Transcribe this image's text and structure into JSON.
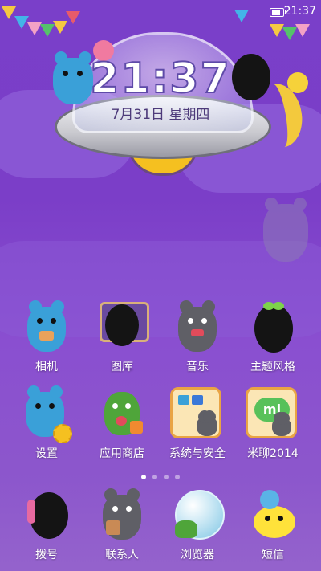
{
  "status_bar": {
    "time": "21:37",
    "battery_icon": "battery-icon"
  },
  "clock_widget": {
    "time": "21:37",
    "date": "7月31日  星期四"
  },
  "page_indicator": {
    "count": 4,
    "active_index": 0
  },
  "apps": [
    {
      "id": "camera",
      "label": "相机",
      "icon": "camera-bear-icon"
    },
    {
      "id": "gallery",
      "label": "图库",
      "icon": "gallery-monster-icon"
    },
    {
      "id": "music",
      "label": "音乐",
      "icon": "music-bear-icon"
    },
    {
      "id": "themes",
      "label": "主题风格",
      "icon": "themes-monster-icon"
    },
    {
      "id": "settings",
      "label": "设置",
      "icon": "settings-bear-icon"
    },
    {
      "id": "app-store",
      "label": "应用商店",
      "icon": "app-store-monster-icon"
    },
    {
      "id": "system-security",
      "label": "系统与安全",
      "icon": "security-folder-icon"
    },
    {
      "id": "miliao",
      "label": "米聊2014",
      "icon": "miliao-icon"
    }
  ],
  "dock": [
    {
      "id": "dialer",
      "label": "拨号",
      "icon": "phone-monster-icon"
    },
    {
      "id": "contacts",
      "label": "联系人",
      "icon": "contacts-bear-icon"
    },
    {
      "id": "browser",
      "label": "浏览器",
      "icon": "browser-globe-icon"
    },
    {
      "id": "messages",
      "label": "短信",
      "icon": "messages-monster-icon"
    }
  ],
  "colors": {
    "background": "#7b3ec8",
    "accent_yellow": "#f5c020",
    "bear_blue": "#3aa0d8",
    "bear_gray": "#5f5f66"
  }
}
